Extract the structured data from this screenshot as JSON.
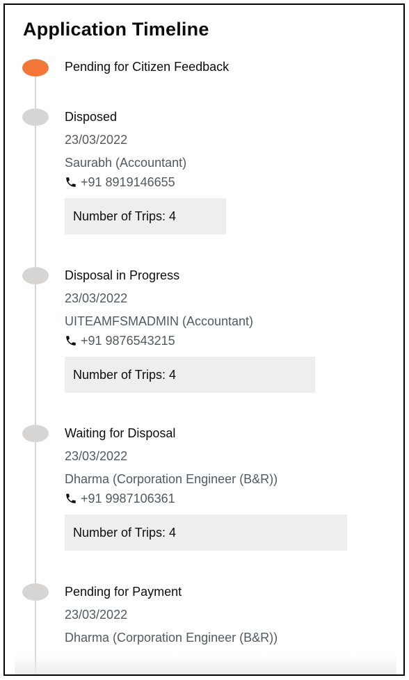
{
  "title": "Application Timeline",
  "timeline": [
    {
      "status": "Pending for Citizen Feedback",
      "active": true
    },
    {
      "status": "Disposed",
      "date": "23/03/2022",
      "assignee": "Saurabh (Accountant)",
      "phone": "+91 8919146655",
      "trips": "Number of Trips: 4"
    },
    {
      "status": "Disposal in Progress",
      "date": "23/03/2022",
      "assignee": "UITEAMFSMADMIN (Accountant)",
      "phone": "+91 9876543215",
      "trips": "Number of Trips: 4"
    },
    {
      "status": "Waiting for Disposal",
      "date": "23/03/2022",
      "assignee": "Dharma (Corporation Engineer (B&R))",
      "phone": "+91 9987106361",
      "trips": "Number of Trips: 4"
    },
    {
      "status": "Pending for Payment",
      "date": "23/03/2022",
      "assignee": "Dharma (Corporation Engineer (B&R))"
    }
  ],
  "icons": {
    "phone": "phone-icon"
  },
  "colors": {
    "active_dot": "#f47738",
    "inactive_dot": "#d6d5d4",
    "secondary_text": "#505a5f",
    "trips_box": "#eeeeee"
  }
}
